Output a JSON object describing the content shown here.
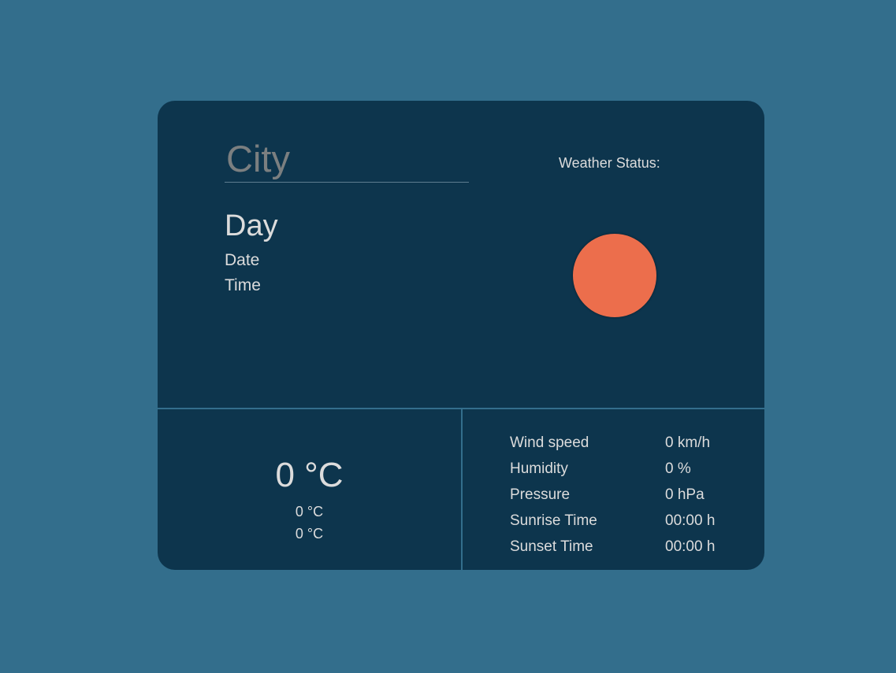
{
  "city": {
    "placeholder": "City",
    "value": ""
  },
  "datetime": {
    "day": "Day",
    "date": "Date",
    "time": "Time"
  },
  "weather": {
    "status_label": "Weather Status:",
    "icon": "sun-icon",
    "icon_color": "#ec6e4c"
  },
  "temperature": {
    "current": "0 °C",
    "min": "0 °C",
    "max": "0 °C"
  },
  "stats": [
    {
      "label": "Wind speed",
      "value": "0 km/h"
    },
    {
      "label": "Humidity",
      "value": "0 %"
    },
    {
      "label": "Pressure",
      "value": "0 hPa"
    },
    {
      "label": "Sunrise Time",
      "value": "00:00 h"
    },
    {
      "label": "Sunset Time",
      "value": "00:00 h"
    }
  ],
  "colors": {
    "background": "#336e8c",
    "card": "#0d354d",
    "text": "#dcdcdc"
  }
}
